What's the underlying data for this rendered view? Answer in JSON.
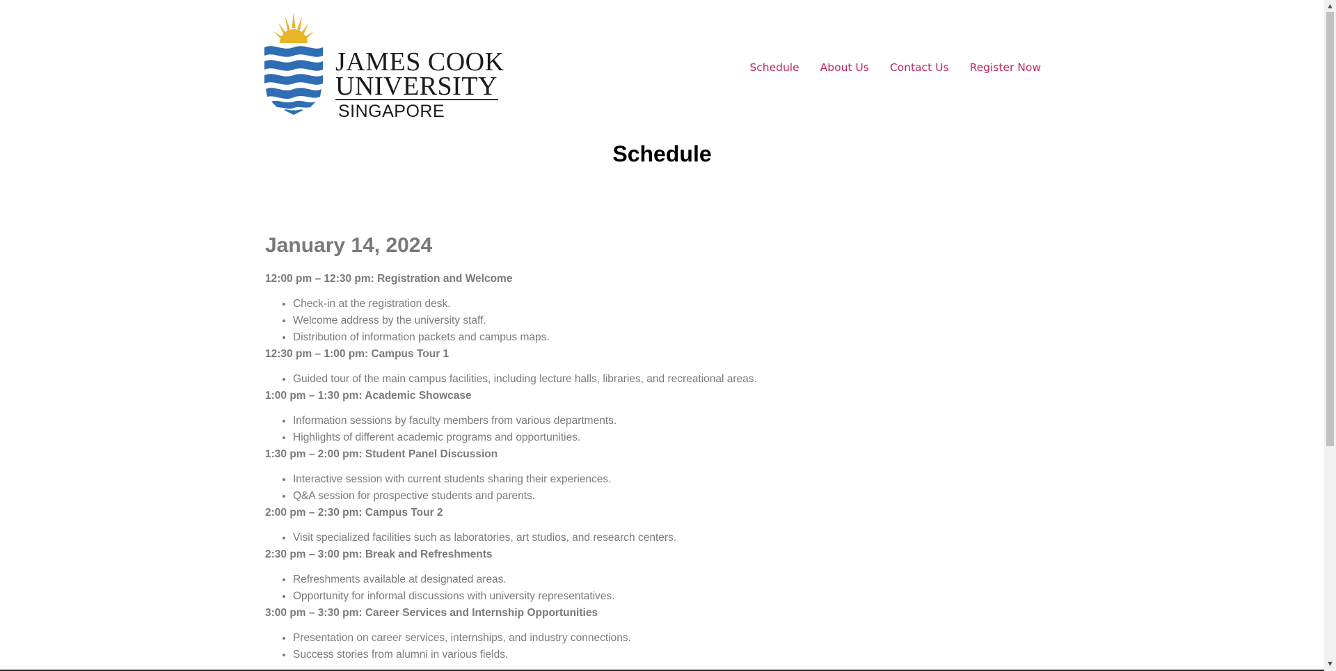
{
  "logo": {
    "line1": "JAMES COOK",
    "line2": "UNIVERSITY",
    "line3": "SINGAPORE",
    "colors": {
      "wave": "#2f6db5",
      "sun": "#e8b528"
    }
  },
  "nav": {
    "items": [
      {
        "label": "Schedule"
      },
      {
        "label": "About Us"
      },
      {
        "label": "Contact Us"
      },
      {
        "label": "Register Now"
      }
    ],
    "color": "#c3245f"
  },
  "page_title": "Schedule",
  "schedule": {
    "date": "January 14, 2024",
    "sessions": [
      {
        "title": "12:00 pm – 12:30 pm: Registration and Welcome",
        "items": [
          "Check-in at the registration desk.",
          "Welcome address by the university staff.",
          "Distribution of information packets and campus maps."
        ]
      },
      {
        "title": "12:30 pm – 1:00 pm: Campus Tour 1",
        "items": [
          "Guided tour of the main campus facilities, including lecture halls, libraries, and recreational areas."
        ]
      },
      {
        "title": "1:00 pm – 1:30 pm: Academic Showcase",
        "items": [
          "Information sessions by faculty members from various departments.",
          "Highlights of different academic programs and opportunities."
        ]
      },
      {
        "title": "1:30 pm – 2:00 pm: Student Panel Discussion",
        "items": [
          "Interactive session with current students sharing their experiences.",
          "Q&A session for prospective students and parents."
        ]
      },
      {
        "title": "2:00 pm – 2:30 pm: Campus Tour 2",
        "items": [
          "Visit specialized facilities such as laboratories, art studios, and research centers."
        ]
      },
      {
        "title": "2:30 pm – 3:00 pm: Break and Refreshments",
        "items": [
          "Refreshments available at designated areas.",
          "Opportunity for informal discussions with university representatives."
        ]
      },
      {
        "title": "3:00 pm – 3:30 pm: Career Services and Internship Opportunities",
        "items": [
          "Presentation on career services, internships, and industry connections.",
          "Success stories from alumni in various fields."
        ]
      }
    ]
  },
  "scrollbar": {
    "up_icon": "▲",
    "down_icon": "▼"
  }
}
